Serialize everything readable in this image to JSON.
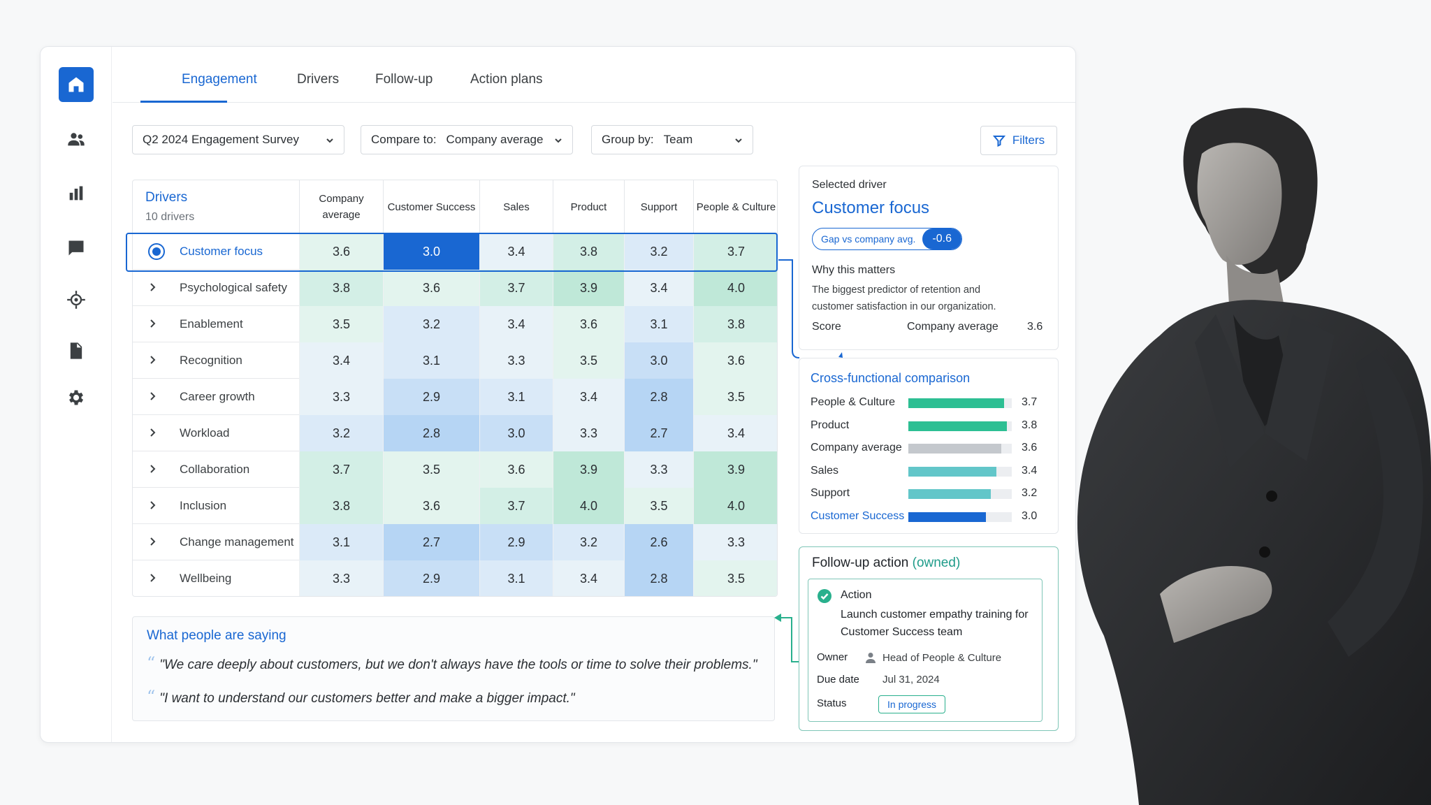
{
  "tabs": [
    "Engagement",
    "Drivers",
    "Follow-up",
    "Action plans"
  ],
  "active_tab": "Engagement",
  "controls": {
    "survey": "Q2 2024 Engagement Survey",
    "compare_label": "Compare to:",
    "compare_value": "Company average",
    "group_label": "Group by:",
    "group_value": "Team",
    "filters": "Filters"
  },
  "table": {
    "title": "Drivers",
    "subtitle": "10 drivers",
    "columns": [
      "Company average",
      "Customer Success",
      "Sales",
      "Product",
      "Support",
      "People & Culture"
    ],
    "rows": [
      {
        "name": "Customer focus",
        "values": [
          "3.6",
          "3.0",
          "3.4",
          "3.8",
          "3.2",
          "3.7"
        ]
      },
      {
        "name": "Psychological safety",
        "values": [
          "3.8",
          "3.6",
          "3.7",
          "3.9",
          "3.4",
          "4.0"
        ]
      },
      {
        "name": "Enablement",
        "values": [
          "3.5",
          "3.2",
          "3.4",
          "3.6",
          "3.1",
          "3.8"
        ]
      },
      {
        "name": "Recognition",
        "values": [
          "3.4",
          "3.1",
          "3.3",
          "3.5",
          "3.0",
          "3.6"
        ]
      },
      {
        "name": "Career growth",
        "values": [
          "3.3",
          "2.9",
          "3.1",
          "3.4",
          "2.8",
          "3.5"
        ]
      },
      {
        "name": "Workload",
        "values": [
          "3.2",
          "2.8",
          "3.0",
          "3.3",
          "2.7",
          "3.4"
        ]
      },
      {
        "name": "Collaboration",
        "values": [
          "3.7",
          "3.5",
          "3.6",
          "3.9",
          "3.3",
          "3.9"
        ]
      },
      {
        "name": "Inclusion",
        "values": [
          "3.8",
          "3.6",
          "3.7",
          "4.0",
          "3.5",
          "4.0"
        ]
      },
      {
        "name": "Change management",
        "values": [
          "3.1",
          "2.7",
          "2.9",
          "3.2",
          "2.6",
          "3.3"
        ]
      },
      {
        "name": "Wellbeing",
        "values": [
          "3.3",
          "2.9",
          "3.1",
          "3.4",
          "2.8",
          "3.5"
        ]
      }
    ],
    "selected_row": 0,
    "highlight_cell": {
      "row": 0,
      "col": 1
    }
  },
  "quotes": {
    "title": "What people are saying",
    "items": [
      "\"We care deeply about customers, but we don't always have the tools or time to solve their problems.\"",
      "\"I want to understand our customers better and make a bigger impact.\""
    ]
  },
  "selected_driver": {
    "label": "Selected driver",
    "name": "Customer focus",
    "gap_label": "Gap vs company avg.",
    "gap_value": "-0.6",
    "why_title": "Why this matters",
    "why_text": "The biggest predictor of retention and customer satisfaction in our organization.",
    "score_label": "Score",
    "score_compare": "Company average",
    "score_value": "3.6"
  },
  "comparison": {
    "title": "Cross-functional comparison",
    "max": 4.0,
    "items": [
      {
        "label": "People & Culture",
        "value": 3.7,
        "display": "3.7",
        "color": "#2dbf93"
      },
      {
        "label": "Product",
        "value": 3.8,
        "display": "3.8",
        "color": "#2dbf93"
      },
      {
        "label": "Company average",
        "value": 3.6,
        "display": "3.6",
        "color": "#c4c8cd"
      },
      {
        "label": "Sales",
        "value": 3.4,
        "display": "3.4",
        "color": "#62c6c9"
      },
      {
        "label": "Support",
        "value": 3.2,
        "display": "3.2",
        "color": "#62c6c9"
      },
      {
        "label": "Customer Success",
        "value": 3.0,
        "display": "3.0",
        "color": "#1967d2",
        "highlight": true
      }
    ]
  },
  "follow_up": {
    "title": "Follow-up action",
    "owned": "(owned)",
    "action_label": "Action",
    "action_text": "Launch customer empathy training for Customer Success team",
    "owner_label": "Owner",
    "owner_value": "Head of People & Culture",
    "due_label": "Due date",
    "due_value": "Jul 31, 2024",
    "status_label": "Status",
    "status_value": "In progress"
  },
  "colors": {
    "accent": "#1967d2",
    "success": "#29b08d"
  }
}
